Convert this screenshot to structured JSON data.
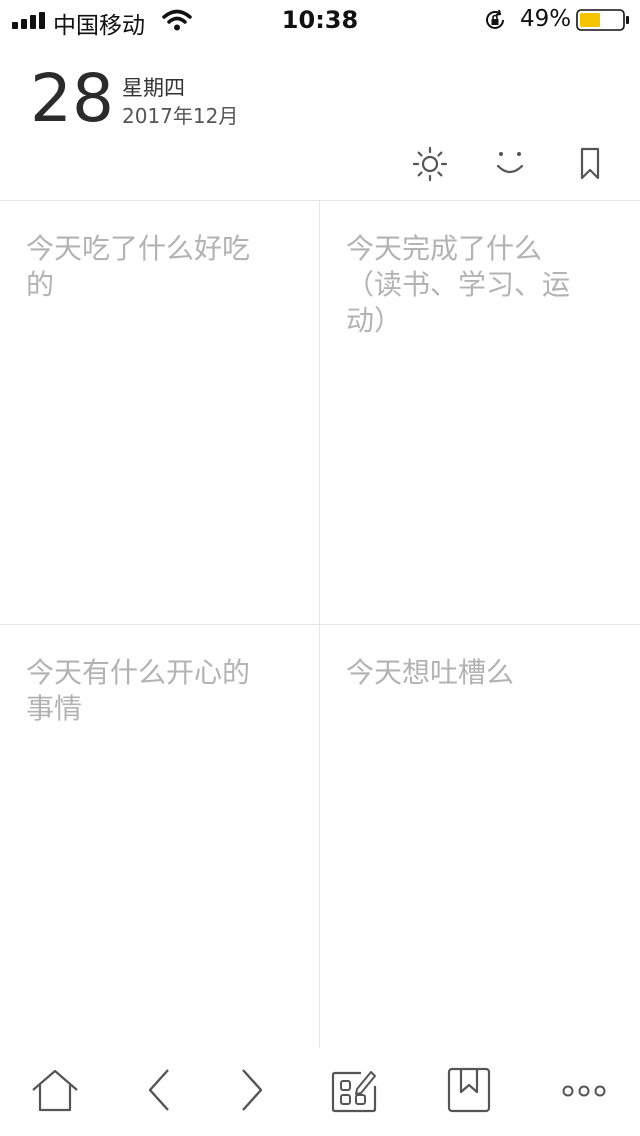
{
  "status_bar": {
    "carrier": "中国移动",
    "time": "10:38",
    "battery_percent": "49%",
    "battery_level": 0.49,
    "battery_color": "#f5c400"
  },
  "header": {
    "day": "28",
    "weekday": "星期四",
    "month": "2017年12月",
    "icons": [
      "sun-icon",
      "smile-icon",
      "bookmark-icon"
    ]
  },
  "cells": [
    {
      "placeholder": "今天吃了什么好吃的"
    },
    {
      "placeholder": "今天完成了什么（读书、学习、运动）"
    },
    {
      "placeholder": "今天有什么开心的事情"
    },
    {
      "placeholder": "今天想吐槽么"
    }
  ],
  "tab_bar": {
    "icons": [
      "home-icon",
      "back-arrow-icon",
      "forward-arrow-icon",
      "edit-apps-icon",
      "bookmark-box-icon",
      "more-icon"
    ]
  },
  "colors": {
    "placeholder": "#b3b3b3",
    "divider": "#e6e6e6",
    "icon_stroke": "#555555"
  }
}
